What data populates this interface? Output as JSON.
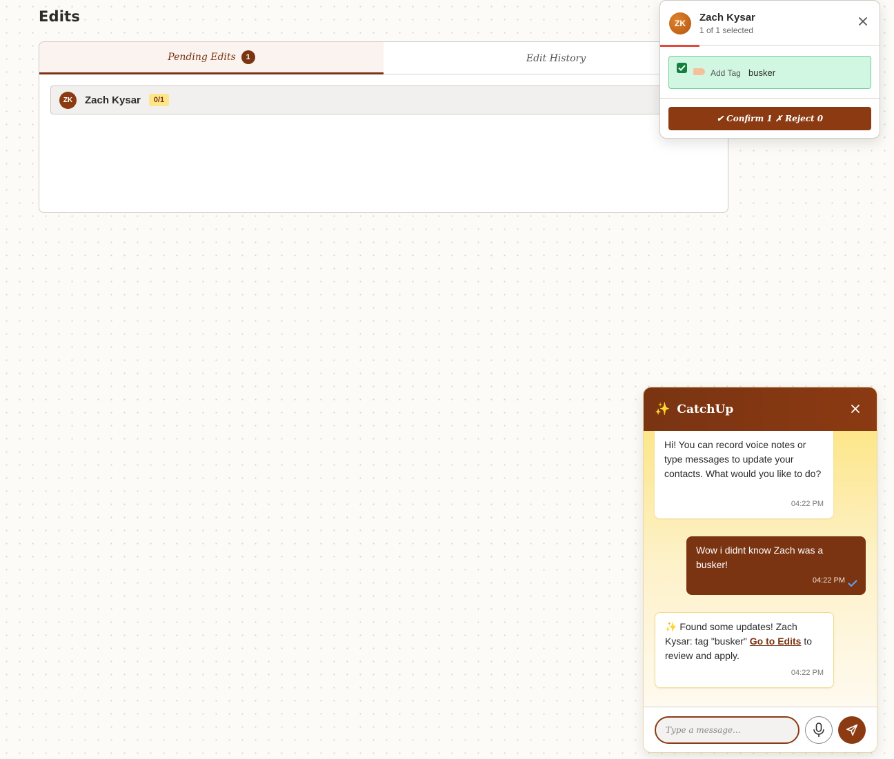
{
  "page": {
    "title": "Edits"
  },
  "tabs": [
    {
      "label": "Pending Edits",
      "badge": "1",
      "active": true
    },
    {
      "label": "Edit History",
      "active": false
    }
  ],
  "pending": {
    "contacts": [
      {
        "initials": "ZK",
        "name": "Zach Kysar",
        "count": "0/1"
      }
    ]
  },
  "popup": {
    "initials": "ZK",
    "name": "Zach Kysar",
    "subtitle": "1 of 1 selected",
    "edits": [
      {
        "checked": true,
        "icon": "tag-icon",
        "type": "Add Tag",
        "value": "busker"
      }
    ],
    "confirm_label": "✔ Confirm 1 ✗ Reject 0"
  },
  "chat": {
    "title": "CatchUp",
    "messages": [
      {
        "from": "bot",
        "text": "Hi! You can record voice notes or type messages to update your contacts. What would you like to do?",
        "time": "04:22 PM"
      },
      {
        "from": "user",
        "text": "Wow i didnt know Zach was a busker!",
        "time": "04:22 PM",
        "read": true
      },
      {
        "from": "bot",
        "text_before": "✨ Found some updates! Zach Kysar: tag \"busker\" ",
        "link": "Go to Edits",
        "text_after": " to review and apply.",
        "time": "04:22 PM"
      }
    ],
    "input_placeholder": "Type a message..."
  },
  "colors": {
    "brand": "#7a3412",
    "badge_yellow": "#fde68a",
    "edit_green_bg": "#d1f7e2",
    "progress_red": "#e04b3c"
  }
}
